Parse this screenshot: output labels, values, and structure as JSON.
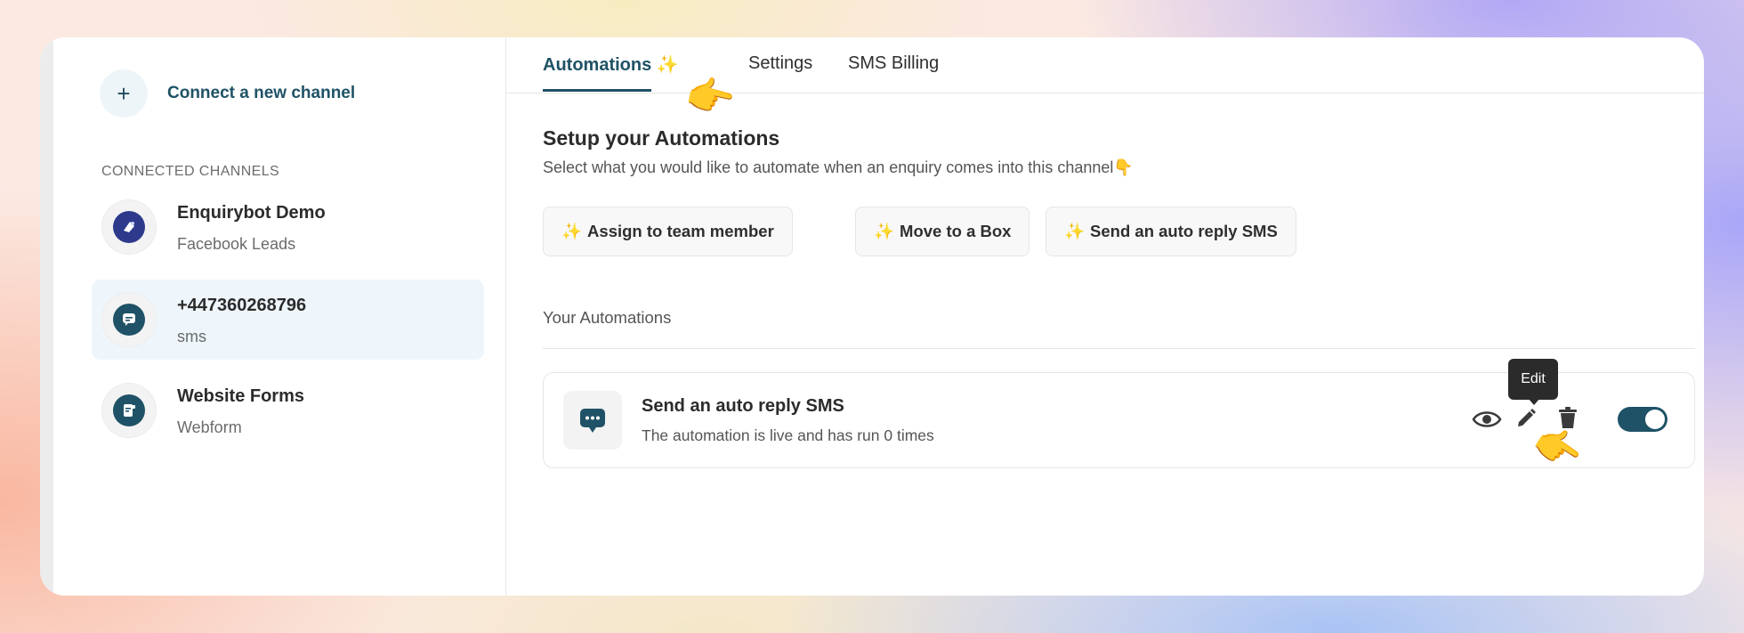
{
  "sidebar": {
    "connect_label": "Connect a new channel",
    "section_label": "CONNECTED CHANNELS",
    "channels": [
      {
        "name": "Enquirybot Demo",
        "sub": "Facebook Leads",
        "icon": "facebook-leads-icon",
        "color": "#2d3a8c"
      },
      {
        "name": "+447360268796",
        "sub": "sms",
        "icon": "sms-icon",
        "color": "#1f5266"
      },
      {
        "name": "Website Forms",
        "sub": "Webform",
        "icon": "webform-icon",
        "color": "#1f5266"
      }
    ]
  },
  "tabs": [
    {
      "label": "Automations ✨"
    },
    {
      "label": "Settings"
    },
    {
      "label": "SMS Billing"
    }
  ],
  "setup": {
    "title": "Setup your Automations",
    "subtitle": "Select what you would like to automate when an enquiry comes into this channel👇"
  },
  "actions": [
    {
      "label": "Assign to team member"
    },
    {
      "label": "Move to a Box"
    },
    {
      "label": "Send an auto reply SMS"
    }
  ],
  "sparkle": "✨",
  "your_automations_label": "Your Automations",
  "automation": {
    "title": "Send an auto reply SMS",
    "subtitle": "The automation is live and has run 0 times",
    "enabled": true
  },
  "tooltip": "Edit",
  "hand": "👈",
  "colors": {
    "accent": "#1f5266"
  }
}
